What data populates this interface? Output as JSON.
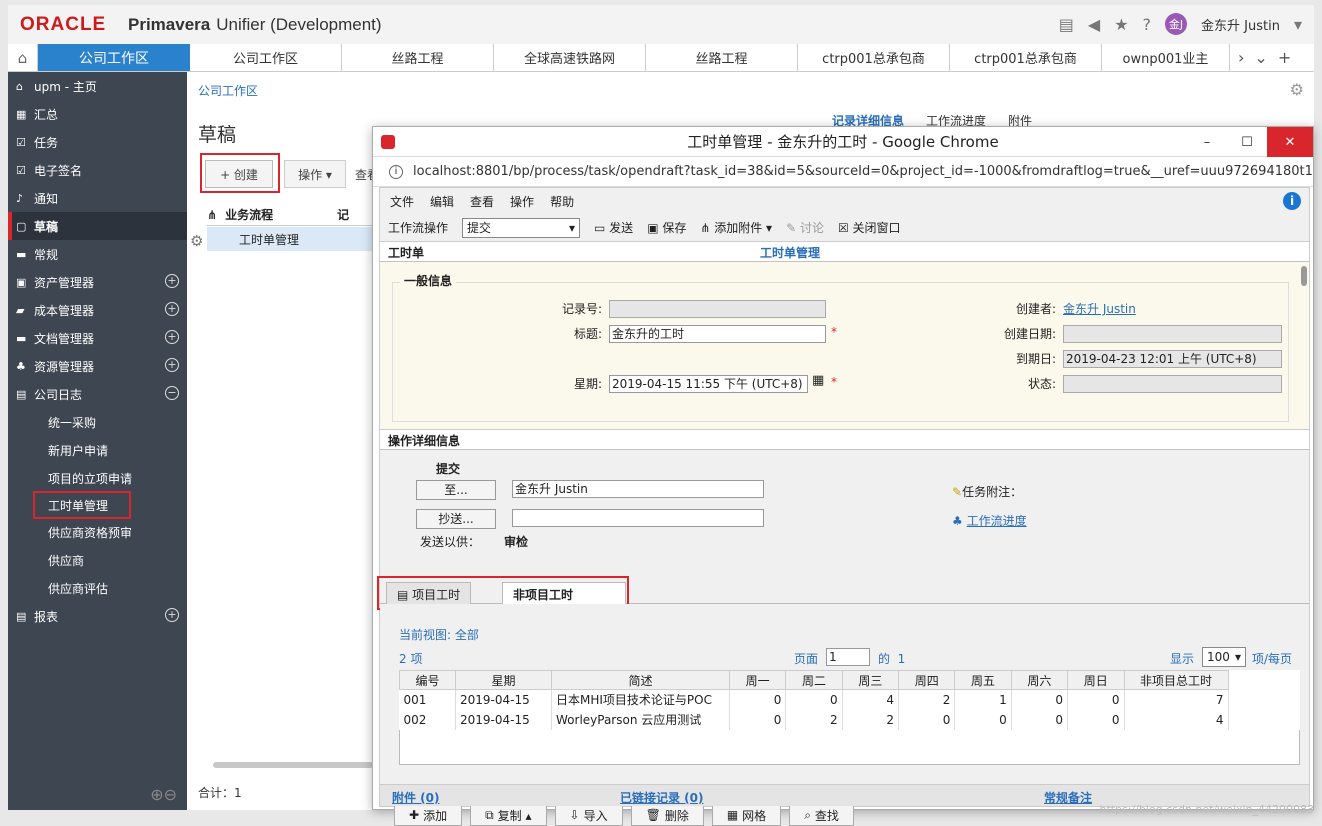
{
  "header": {
    "logo": "ORACLE",
    "product_bold": "Primavera",
    "product_rest": "Unifier  (Development)",
    "avatar_text": "金J",
    "user_name": "金东升 Justin"
  },
  "tabs": {
    "active": "公司工作区",
    "items": [
      "公司工作区",
      "丝路工程",
      "全球高速铁路网",
      "丝路工程",
      "ctrp001总承包商",
      "ctrp001总承包商",
      "ownp001业主"
    ]
  },
  "sidebar": {
    "items": [
      {
        "label": "upm - 主页",
        "icon": "⌂"
      },
      {
        "label": "汇总",
        "icon": "▦"
      },
      {
        "label": "任务",
        "icon": "☑"
      },
      {
        "label": "电子签名",
        "icon": "☑"
      },
      {
        "label": "通知",
        "icon": "♪"
      },
      {
        "label": "草稿",
        "icon": "▢"
      },
      {
        "label": "常规",
        "icon": "▬"
      },
      {
        "label": "资产管理器",
        "icon": "▣"
      },
      {
        "label": "成本管理器",
        "icon": "▰"
      },
      {
        "label": "文档管理器",
        "icon": "▬"
      },
      {
        "label": "资源管理器",
        "icon": "♣"
      },
      {
        "label": "公司日志",
        "icon": "▤"
      }
    ],
    "log_subs": [
      "统一采购",
      "新用户申请",
      "项目的立项申请",
      "工时单管理",
      "供应商资格预审",
      "供应商",
      "供应商评估"
    ],
    "reports": "报表"
  },
  "main": {
    "breadcrumb": "公司工作区",
    "title": "草稿",
    "create": "+ 创建",
    "operations": "操作 ▾",
    "search": "查看",
    "col_attach": "⋔",
    "col_process": "业务流程",
    "col_extra": "记",
    "row_process": "工时单管理",
    "total": "合计：1",
    "bg_tabs": [
      "记录详细信息",
      "工作流进度",
      "附件"
    ]
  },
  "popup": {
    "title": "工时单管理 - 金东升的工时 - Google Chrome",
    "url": "localhost:8801/bp/process/task/opendraft?task_id=38&id=5&sourceId=0&project_id=-1000&fromdraftlog=true&__uref=uuu972694180t1",
    "menu": [
      "文件",
      "编辑",
      "查看",
      "操作",
      "帮助"
    ],
    "wf_label": "工作流操作",
    "wf_value": "提交",
    "toolbar": [
      "发送",
      "保存",
      "添加附件 ▾",
      "讨论",
      "关闭窗口"
    ],
    "section_label": "工时单",
    "section_center": "工时单管理",
    "group_title": "一般信息",
    "fields": {
      "record_no": "记录号:",
      "title_label": "标题:",
      "title_value": "金东升的工时",
      "week_label": "星期:",
      "week_value": "2019-04-15 11:55 下午 (UTC+8)",
      "creator_label": "创建者:",
      "creator_value": "金东升 Justin",
      "created_label": "创建日期:",
      "due_label": "到期日:",
      "due_value": "2019-04-23 12:01 上午 (UTC+8)",
      "status_label": "状态:"
    },
    "ops_section": "操作详细信息",
    "ops": {
      "submit": "提交",
      "to_btn": "至...",
      "to_value": "金东升 Justin",
      "cc_btn": "抄送...",
      "send_for": "发送以供：",
      "send_value": "审检",
      "task_note": "任务附注：",
      "wf_progress": "工作流进度"
    },
    "subtabs": [
      "项目工时",
      "非项目工时"
    ],
    "grid": {
      "view_label": "当前视图:",
      "view_value": "全部",
      "count": "2 项",
      "page_label": "页面",
      "page_value": "1",
      "of_label": "的",
      "of_value": "1",
      "show_label": "显示",
      "show_value": "100",
      "per_page": "项/每页",
      "columns": [
        "编号",
        "星期",
        "简述",
        "周一",
        "周二",
        "周三",
        "周四",
        "周五",
        "周六",
        "周日",
        "非项目总工时"
      ],
      "rows": [
        [
          "001",
          "2019-04-15",
          "日本MHI项目技术论证与POC",
          "0",
          "0",
          "4",
          "2",
          "1",
          "0",
          "0",
          "7"
        ],
        [
          "002",
          "2019-04-15",
          "WorleyParson 云应用测试",
          "0",
          "2",
          "2",
          "0",
          "0",
          "0",
          "0",
          "4"
        ]
      ]
    },
    "bottom_buttons": [
      "添加",
      "复制 ▴",
      "导入",
      "删除",
      "网格",
      "查找"
    ],
    "footer": [
      "附件 (0)",
      "已链接记录 (0)",
      "常规备注"
    ]
  },
  "watermark": "https://blog.csdn.net/weixin_44290083"
}
